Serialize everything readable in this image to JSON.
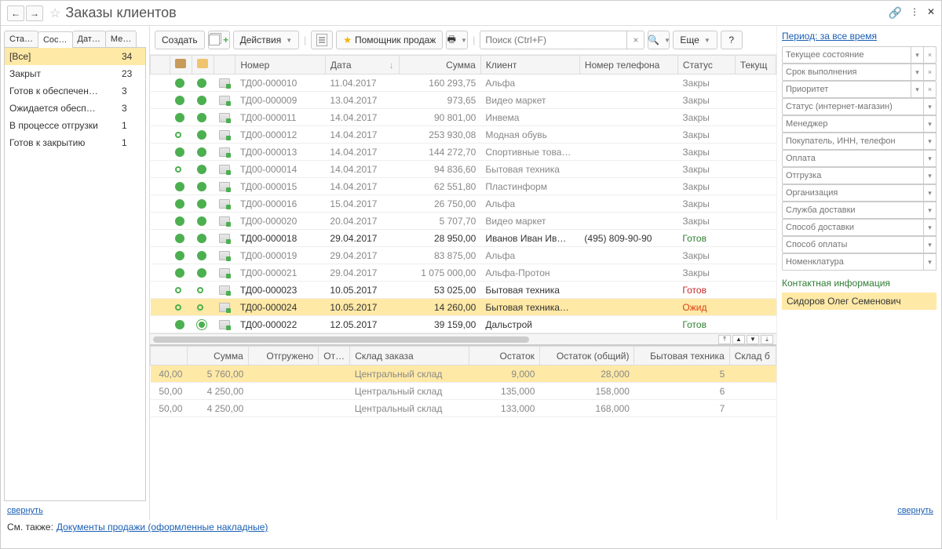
{
  "header": {
    "title": "Заказы клиентов"
  },
  "left_tabs": [
    "Ста…",
    "Сос…",
    "Дат…",
    "Ме…"
  ],
  "left_active_tab": 1,
  "statuses": [
    {
      "label": "[Все]",
      "count": "34",
      "sel": true
    },
    {
      "label": "Закрыт",
      "count": "23"
    },
    {
      "label": "Готов к обеспечен…",
      "count": "3"
    },
    {
      "label": "Ожидается обесп…",
      "count": "3"
    },
    {
      "label": "В процессе отгрузки",
      "count": "1"
    },
    {
      "label": "Готов к закрытию",
      "count": "1"
    }
  ],
  "collapse": "свернуть",
  "toolbar": {
    "create": "Создать",
    "actions": "Действия",
    "assistant": "Помощник продаж",
    "search_ph": "Поиск (Ctrl+F)",
    "more": "Еще",
    "help": "?"
  },
  "columns": [
    "",
    "",
    "",
    "",
    "Номер",
    "Дата",
    "Сумма",
    "Клиент",
    "Номер телефона",
    "Статус",
    "Текущ"
  ],
  "rows": [
    {
      "d1": "f",
      "d2": "f",
      "num": "ТД00-000010",
      "date": "11.04.2017",
      "sum": "160 293,75",
      "client": "Альфа",
      "phone": "",
      "status": "Закры",
      "cls": ""
    },
    {
      "d1": "f",
      "d2": "f",
      "num": "ТД00-000009",
      "date": "13.04.2017",
      "sum": "973,65",
      "client": "Видео маркет",
      "phone": "",
      "status": "Закры",
      "cls": ""
    },
    {
      "d1": "f",
      "d2": "f",
      "num": "ТД00-000011",
      "date": "14.04.2017",
      "sum": "90 801,00",
      "client": "Инвема",
      "phone": "",
      "status": "Закры",
      "cls": ""
    },
    {
      "d1": "o",
      "d2": "f",
      "num": "ТД00-000012",
      "date": "14.04.2017",
      "sum": "253 930,08",
      "client": "Модная обувь",
      "phone": "",
      "status": "Закры",
      "cls": ""
    },
    {
      "d1": "f",
      "d2": "f",
      "num": "ТД00-000013",
      "date": "14.04.2017",
      "sum": "144 272,70",
      "client": "Спортивные това…",
      "phone": "",
      "status": "Закры",
      "cls": ""
    },
    {
      "d1": "o",
      "d2": "f",
      "num": "ТД00-000014",
      "date": "14.04.2017",
      "sum": "94 836,60",
      "client": "Бытовая техника",
      "phone": "",
      "status": "Закры",
      "cls": ""
    },
    {
      "d1": "f",
      "d2": "f",
      "num": "ТД00-000015",
      "date": "14.04.2017",
      "sum": "62 551,80",
      "client": "Пластинформ",
      "phone": "",
      "status": "Закры",
      "cls": ""
    },
    {
      "d1": "f",
      "d2": "f",
      "num": "ТД00-000016",
      "date": "15.04.2017",
      "sum": "26 750,00",
      "client": "Альфа",
      "phone": "",
      "status": "Закры",
      "cls": ""
    },
    {
      "d1": "f",
      "d2": "f",
      "num": "ТД00-000020",
      "date": "20.04.2017",
      "sum": "5 707,70",
      "client": "Видео маркет",
      "phone": "",
      "status": "Закры",
      "cls": ""
    },
    {
      "d1": "f",
      "d2": "f",
      "num": "ТД00-000018",
      "date": "29.04.2017",
      "sum": "28 950,00",
      "client": "Иванов Иван Ив…",
      "phone": "(495) 809-90-90",
      "status": "Готов",
      "scls": "txt-green",
      "cls": "black"
    },
    {
      "d1": "f",
      "d2": "f",
      "num": "ТД00-000019",
      "date": "29.04.2017",
      "sum": "83 875,00",
      "client": "Альфа",
      "phone": "",
      "status": "Закры",
      "cls": ""
    },
    {
      "d1": "f",
      "d2": "f",
      "num": "ТД00-000021",
      "date": "29.04.2017",
      "sum": "1 075 000,00",
      "client": "Альфа-Протон",
      "phone": "",
      "status": "Закры",
      "cls": ""
    },
    {
      "d1": "o",
      "d2": "o",
      "num": "ТД00-000023",
      "date": "10.05.2017",
      "sum": "53 025,00",
      "client": "Бытовая техника",
      "phone": "",
      "status": "Готов",
      "scls": "txt-red",
      "cls": "black"
    },
    {
      "d1": "o",
      "d2": "o",
      "num": "ТД00-000024",
      "date": "10.05.2017",
      "sum": "14 260,00",
      "client": "Бытовая техника…",
      "phone": "",
      "status": "Ожид",
      "scls": "txt-orange",
      "cls": "black sel"
    },
    {
      "d1": "f",
      "d2": "c",
      "num": "ТД00-000022",
      "date": "12.05.2017",
      "sum": "39 159,00",
      "client": "Дальстрой",
      "phone": "",
      "status": "Готов",
      "scls": "txt-green",
      "cls": "black"
    }
  ],
  "detail_columns": [
    "",
    "Сумма",
    "Отгружено",
    "От…",
    "Склад заказа",
    "Остаток",
    "Остаток (общий)",
    "Бытовая техника",
    "Склад б"
  ],
  "detail_rows": [
    {
      "a": "40,00",
      "sum": "5 760,00",
      "ship": "",
      "ot": "",
      "wh": "Центральный склад",
      "rest": "9,000",
      "restg": "28,000",
      "bt": "5",
      "wb": "",
      "sel": true
    },
    {
      "a": "50,00",
      "sum": "4 250,00",
      "ship": "",
      "ot": "",
      "wh": "Центральный склад",
      "rest": "135,000",
      "restg": "158,000",
      "bt": "6",
      "wb": ""
    },
    {
      "a": "50,00",
      "sum": "4 250,00",
      "ship": "",
      "ot": "",
      "wh": "Центральный склад",
      "rest": "133,000",
      "restg": "168,000",
      "bt": "7",
      "wb": ""
    }
  ],
  "period": "Период: за все время",
  "filters": [
    {
      "ph": "Текущее состояние",
      "x": true
    },
    {
      "ph": "Срок выполнения",
      "x": true
    },
    {
      "ph": "Приоритет",
      "x": true
    },
    {
      "ph": "Статус (интернет-магазин)"
    },
    {
      "ph": "Менеджер"
    },
    {
      "ph": "Покупатель, ИНН, телефон"
    },
    {
      "ph": "Оплата"
    },
    {
      "ph": "Отгрузка"
    },
    {
      "ph": "Организация"
    },
    {
      "ph": "Служба доставки"
    },
    {
      "ph": "Способ доставки"
    },
    {
      "ph": "Способ оплаты"
    },
    {
      "ph": "Номенклатура"
    }
  ],
  "contact_header": "Контактная информация",
  "contact_name": "Сидоров Олег Семенович",
  "footer": {
    "see_also": "См. также:",
    "link": "Документы продажи (оформленные накладные)"
  }
}
